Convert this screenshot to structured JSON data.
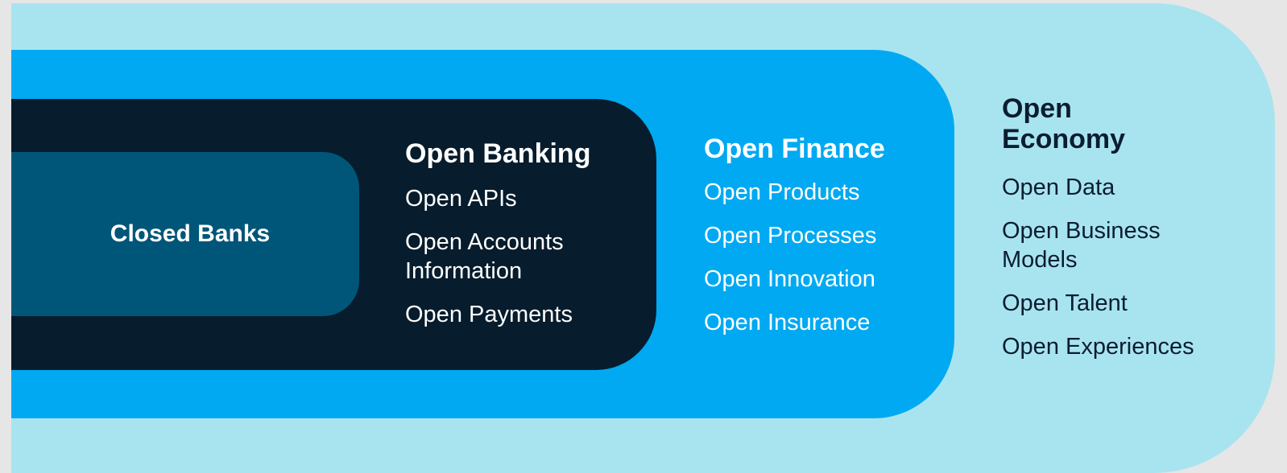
{
  "colors": {
    "page_background": "#e6e6e6",
    "open_economy_fill": "#a8e4ef",
    "open_finance_fill": "#00a9f1",
    "open_banking_fill": "#071c2c",
    "closed_banks_fill": "#005678",
    "dark_text": "#0b1d30",
    "light_text": "#ffffff"
  },
  "closed_banks": {
    "label": "Closed Banks"
  },
  "open_banking": {
    "title": "Open Banking",
    "items": [
      "Open APIs",
      "Open Accounts Information",
      "Open Payments"
    ]
  },
  "open_finance": {
    "title": "Open Finance",
    "items": [
      "Open Products",
      "Open Processes",
      "Open Innovation",
      "Open Insurance"
    ]
  },
  "open_economy": {
    "title": "Open Economy",
    "items": [
      "Open Data",
      "Open Business Models",
      "Open Talent",
      "Open Experiences"
    ]
  }
}
